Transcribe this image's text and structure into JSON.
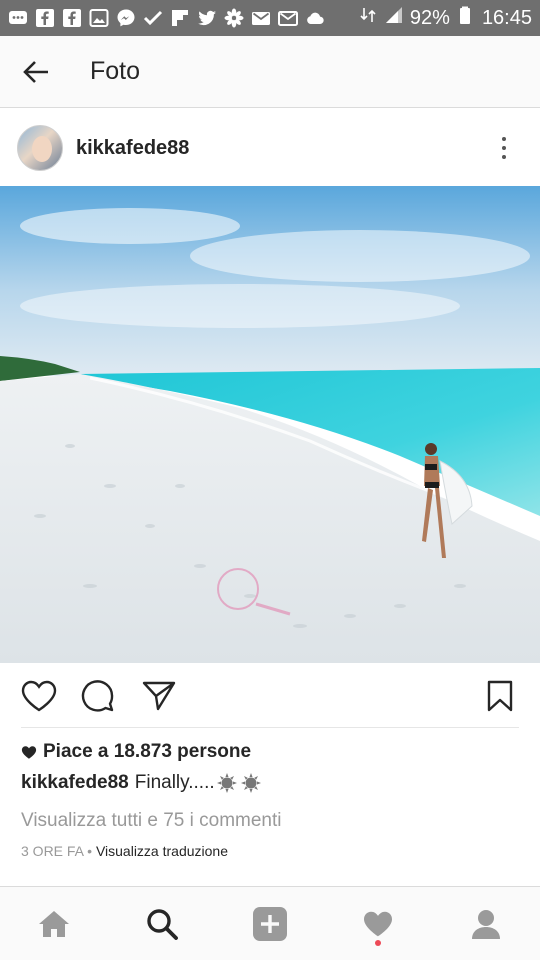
{
  "status_bar": {
    "battery": "92%",
    "time": "16:45",
    "icons": [
      "messages-icon",
      "facebook-icon",
      "facebook-icon",
      "gallery-icon",
      "messenger-icon",
      "check-icon",
      "flipboard-icon",
      "twitter-icon",
      "flower-icon",
      "gmail-icon",
      "gmail-icon",
      "cloud-icon"
    ]
  },
  "app_bar": {
    "title": "Foto"
  },
  "post": {
    "username": "kikkafede88",
    "likes_text": "Piace a 18.873 persone",
    "caption_user": "kikkafede88",
    "caption_text": "Finally.....",
    "comments_link": "Visualizza tutti e 75 i commenti",
    "time_ago": "3 ORE FA",
    "separator": " • ",
    "translate": "Visualizza traduzione"
  },
  "colors": {
    "status_bar_bg": "#6f6f6f",
    "app_bar_bg": "#fafafa",
    "text_primary": "#262626",
    "text_secondary": "#999999",
    "notification_dot": "#ed4956",
    "nav_icon": "#9a9a9a"
  }
}
